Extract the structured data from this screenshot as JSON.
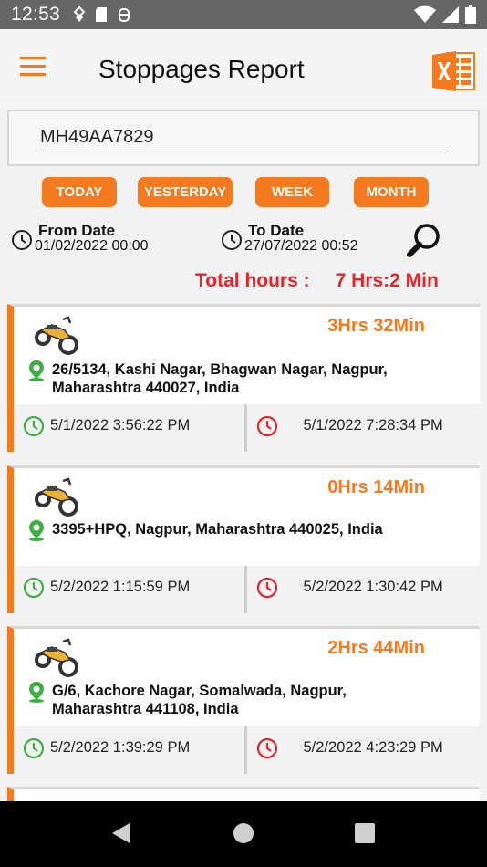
{
  "status": {
    "time": "12:53"
  },
  "app": {
    "title": "Stoppages Report"
  },
  "vehicle": {
    "value": "MH49AA7829"
  },
  "periods": [
    {
      "label": "TODAY"
    },
    {
      "label": "YESTERDAY"
    },
    {
      "label": "WEEK"
    },
    {
      "label": "MONTH"
    }
  ],
  "range": {
    "from_label": "From Date",
    "from_value": "01/02/2022 00:00",
    "to_label": "To Date",
    "to_value": "27/07/2022 00:52"
  },
  "total": {
    "label": "Total hours :",
    "value": "7 Hrs:2 Min"
  },
  "stoppages": [
    {
      "duration": "3Hrs 32Min",
      "address_line1": "26/5134, Kashi Nagar, Bhagwan Nagar, Nagpur,",
      "address_line2": "Maharashtra 440027, India",
      "start": "5/1/2022 3:56:22 PM",
      "end": "5/1/2022 7:28:34 PM"
    },
    {
      "duration": "0Hrs 14Min",
      "address_line1": "3395+HPQ, Nagpur, Maharashtra 440025, India",
      "address_line2": "",
      "start": "5/2/2022 1:15:59 PM",
      "end": "5/2/2022 1:30:42 PM"
    },
    {
      "duration": "2Hrs 44Min",
      "address_line1": "G/6, Kachore Nagar, Somalwada, Nagpur,",
      "address_line2": "Maharashtra 441108, India",
      "start": "5/2/2022 1:39:29 PM",
      "end": "5/2/2022 4:23:29 PM"
    }
  ],
  "colors": {
    "accent": "#f47a20",
    "total": "#e3262b",
    "start_icon": "#3cb043",
    "end_icon": "#e3262b"
  }
}
